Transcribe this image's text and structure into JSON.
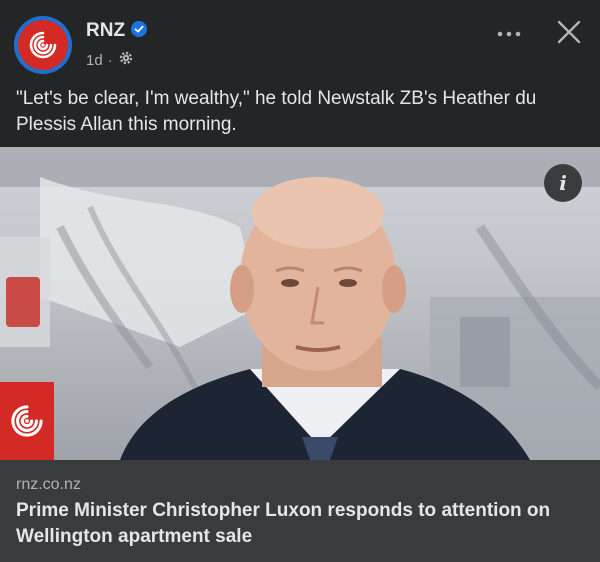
{
  "post": {
    "page_name": "RNZ",
    "verified_icon": "verified-badge-icon",
    "time_ago": "1d",
    "separator": "·",
    "audience_icon": "globe-gear-icon",
    "text": "\"Let's be clear, I'm wealthy,\" he told Newstalk ZB's Heather du Plessis Allan this morning."
  },
  "header_actions": {
    "more_icon": "more-dots-icon",
    "close_icon": "close-icon"
  },
  "link_card": {
    "domain": "rnz.co.nz",
    "headline": "Prime Minister Christopher Luxon responds to attention on Wellington apartment sale",
    "info_label": "i"
  },
  "colors": {
    "background": "#242526",
    "card": "#3a3b3c",
    "brand_red": "#d42a26",
    "verified_blue": "#1b74e4",
    "text_primary": "#e4e6eb",
    "text_secondary": "#b0b3b8"
  }
}
